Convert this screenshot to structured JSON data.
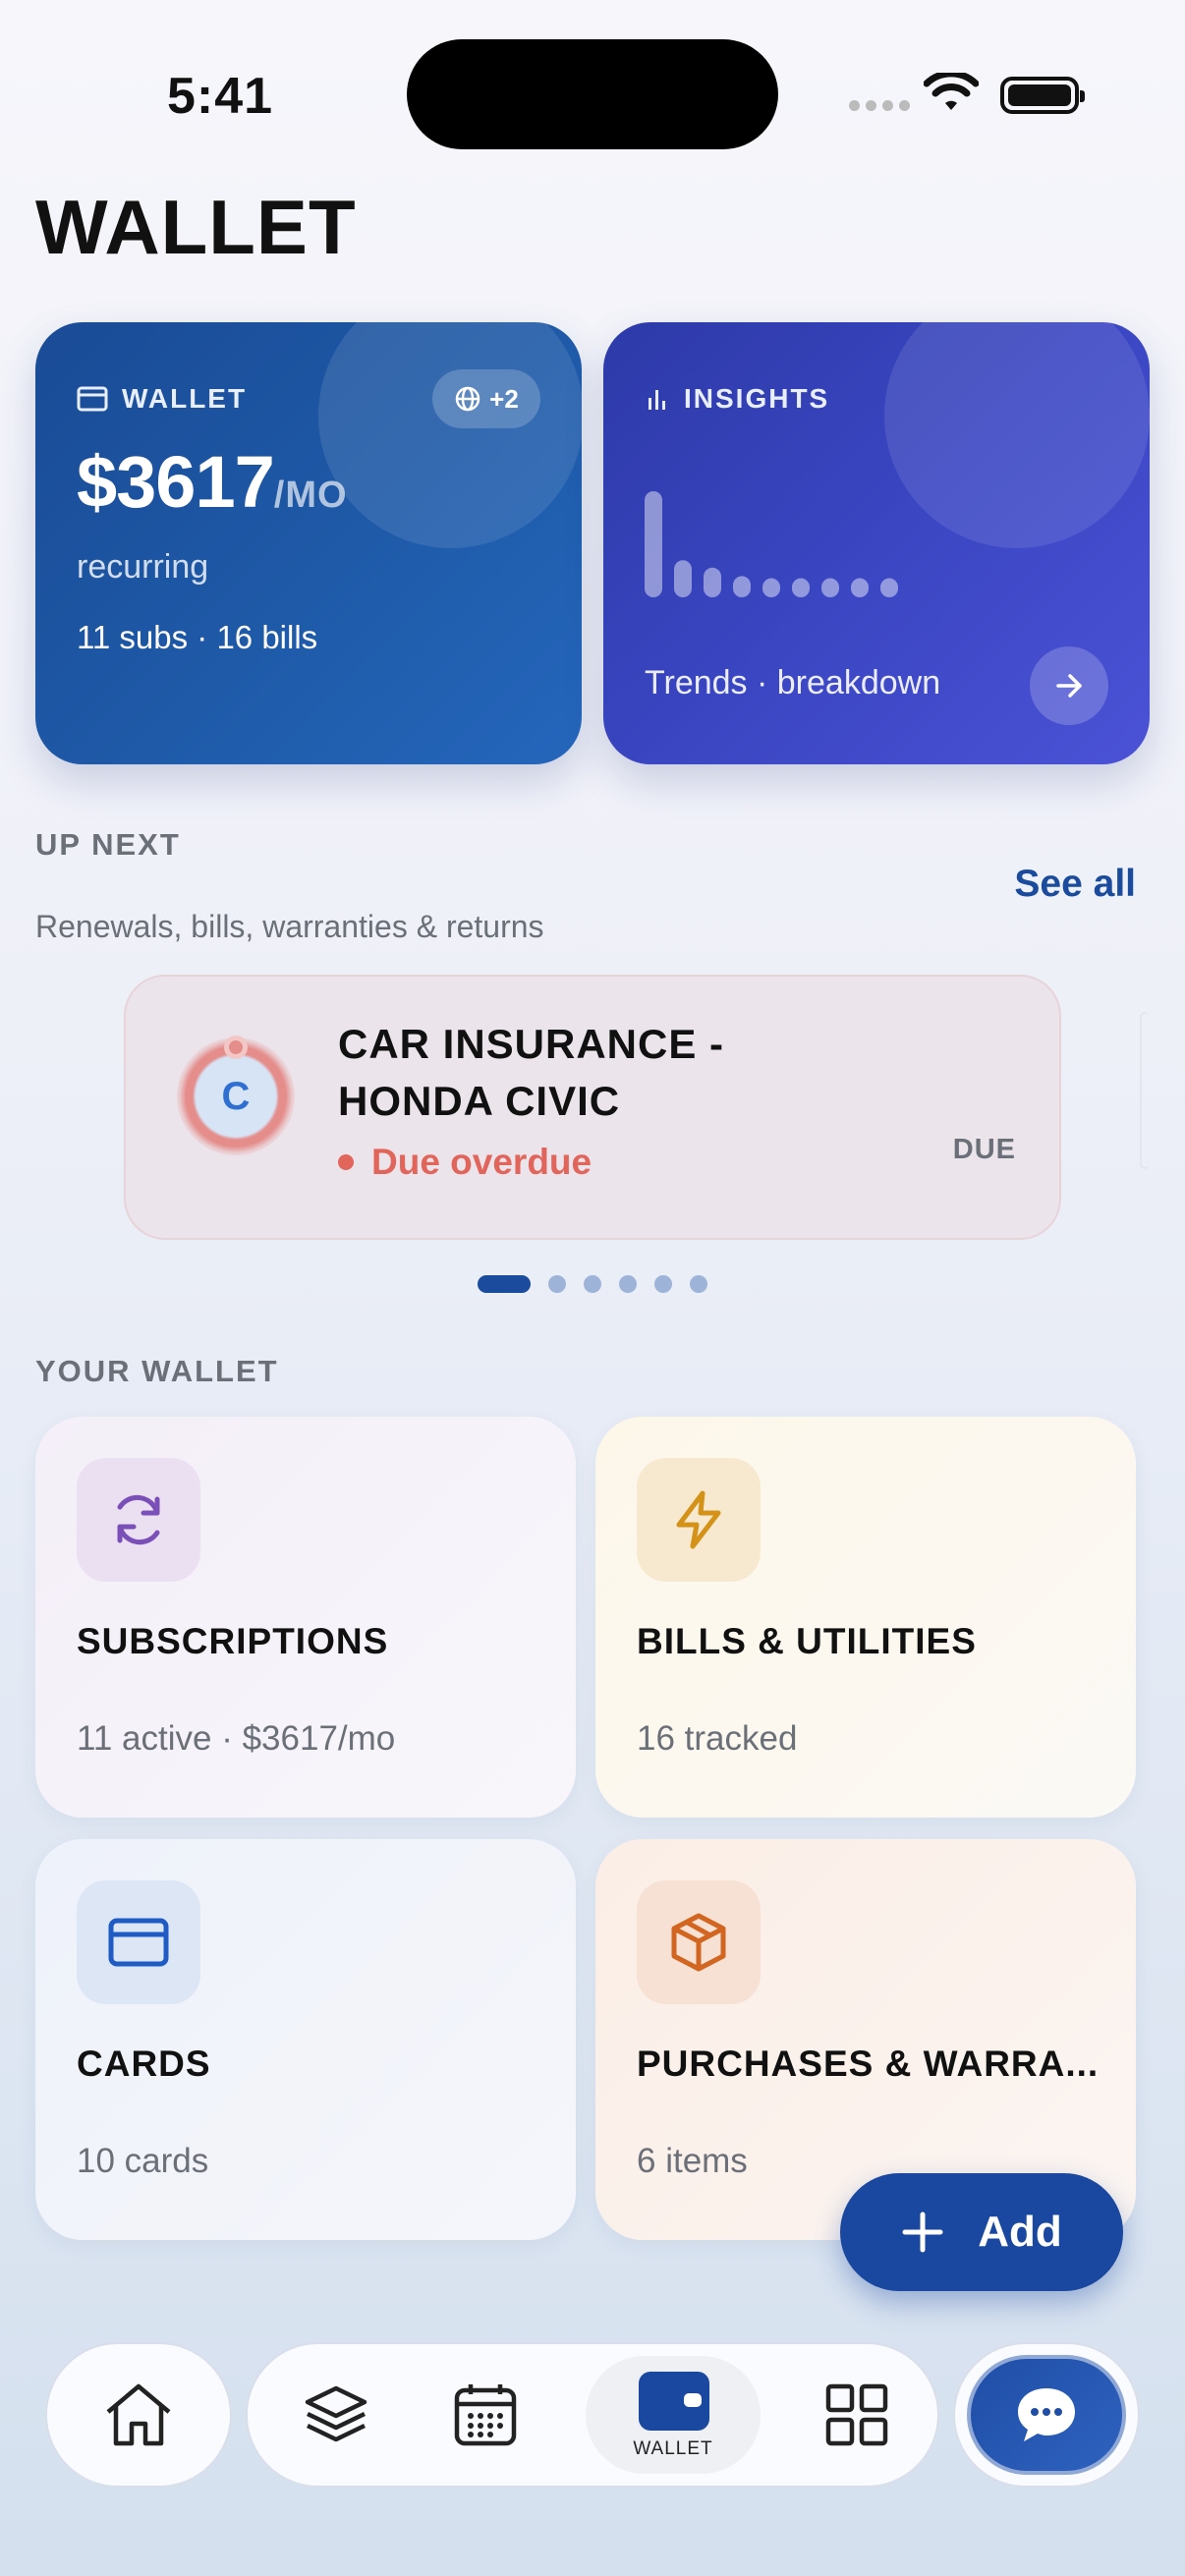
{
  "status_bar": {
    "time": "5:41"
  },
  "page_title": "WALLET",
  "wallet_card": {
    "label": "WALLET",
    "amount": "$3617",
    "unit": "/MO",
    "recurring": "recurring",
    "counts": "11 subs · 16 bills",
    "globe_badge": "+2",
    "icon": "credit-card-icon"
  },
  "insights_card": {
    "label": "INSIGHTS",
    "trend_text": "Trends · breakdown",
    "icon": "bar-chart-icon",
    "bar_levels": [
      1.0,
      0.35,
      0.28,
      0.2,
      0.18,
      0.18,
      0.18,
      0.18,
      0.18
    ]
  },
  "up_next": {
    "title": "UP NEXT",
    "subtitle": "Renewals, bills, warranties & returns",
    "see_all": "See all",
    "item": {
      "initial": "C",
      "title": "CAR INSURANCE - HONDA CIVIC",
      "status": "Due overdue",
      "badge": "DUE"
    },
    "pager_count": 6,
    "pager_active": 0
  },
  "your_wallet": {
    "title": "YOUR WALLET",
    "tiles": [
      {
        "title": "SUBSCRIPTIONS",
        "subtitle": "11 active · $3617/mo",
        "icon": "refresh-icon",
        "color": "#7b4fb8"
      },
      {
        "title": "BILLS & UTILITIES",
        "subtitle": "16 tracked",
        "icon": "lightning-icon",
        "color": "#d49219"
      },
      {
        "title": "CARDS",
        "subtitle": "10 cards",
        "icon": "credit-card-icon",
        "color": "#1f5bc4"
      },
      {
        "title": "PURCHASES & WARRA...",
        "subtitle": "6 items",
        "icon": "package-icon",
        "color": "#d2651f"
      }
    ]
  },
  "add_button": {
    "label": "Add"
  },
  "bottom_nav": {
    "home": "home-icon",
    "items": [
      "layers-icon",
      "calendar-icon",
      "wallet-icon",
      "grid-icon"
    ],
    "wallet_label": "WALLET",
    "chat": "chat-icon"
  }
}
